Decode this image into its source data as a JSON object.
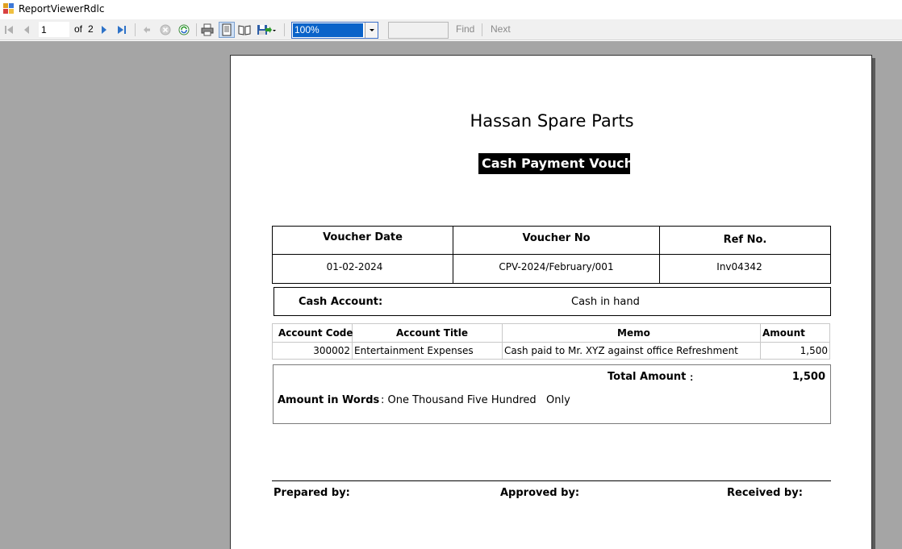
{
  "window": {
    "title": "ReportViewerRdlc"
  },
  "toolbar": {
    "current_page": "1",
    "of_label": "of",
    "total_pages": "2",
    "zoom": "100%",
    "find_label": "Find",
    "next_label": "Next",
    "find_placeholder": ""
  },
  "report": {
    "company": "Hassan Spare Parts",
    "voucher_title": "Cash Payment Vouche",
    "header": {
      "labels": [
        "Voucher Date",
        "Voucher No",
        "Ref No."
      ],
      "values": [
        "01-02-2024",
        "CPV-2024/February/001",
        "Inv04342"
      ]
    },
    "cash_account": {
      "label": "Cash Account:",
      "value": "Cash in hand"
    },
    "lines": {
      "columns": [
        "Account Code",
        "Account Title",
        "Memo",
        "Amount"
      ],
      "rows": [
        [
          "300002",
          "Entertainment Expenses",
          "Cash paid to Mr. XYZ against office Refreshment",
          "1,500"
        ]
      ]
    },
    "totals": {
      "total_label": "Total Amount",
      "colon": ":",
      "total_value": "1,500",
      "words_label": "Amount in Words",
      "words_value": ": One Thousand Five Hundred   Only"
    },
    "signatures": {
      "prepared": "Prepared by:",
      "approved": "Approved by:",
      "received": "Received by:"
    }
  }
}
